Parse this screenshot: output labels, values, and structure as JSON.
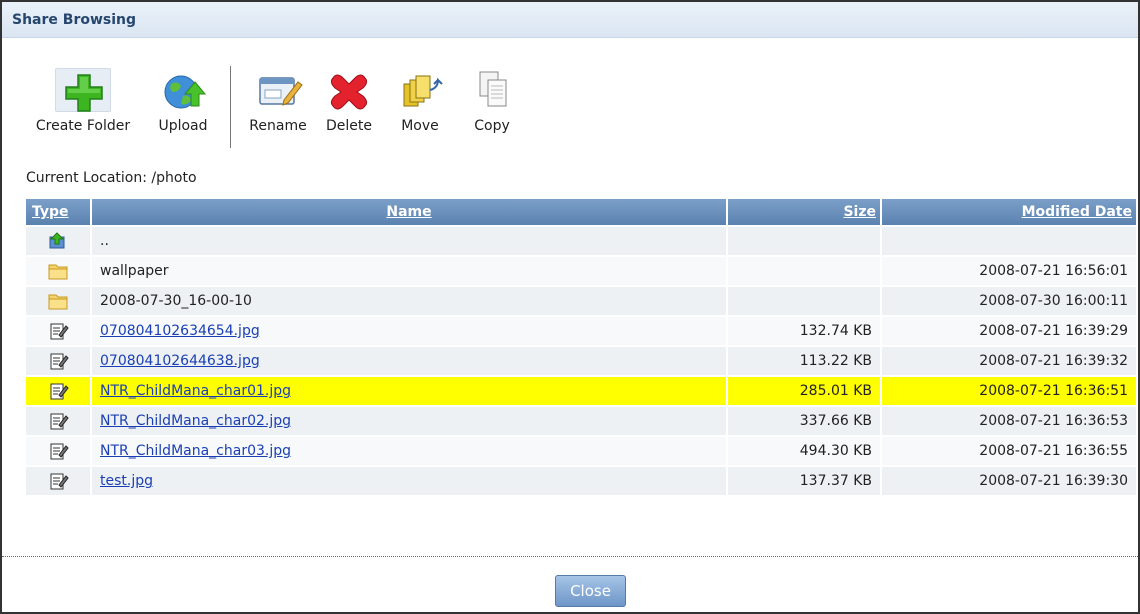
{
  "window": {
    "title": "Share Browsing"
  },
  "toolbar": {
    "create_folder": "Create Folder",
    "upload": "Upload",
    "rename": "Rename",
    "delete": "Delete",
    "move": "Move",
    "copy": "Copy"
  },
  "location": {
    "text": "Current Location: /photo"
  },
  "table": {
    "headers": {
      "type": "Type",
      "name": "Name",
      "size": "Size",
      "modified": "Modified Date"
    },
    "rows": [
      {
        "icon": "parent-folder-icon",
        "name": "..",
        "size": "",
        "modified": ""
      },
      {
        "icon": "folder-icon",
        "name": "wallpaper",
        "size": "",
        "modified": "2008-07-21 16:56:01"
      },
      {
        "icon": "folder-icon",
        "name": "2008-07-30_16-00-10",
        "size": "",
        "modified": "2008-07-30 16:00:11"
      },
      {
        "icon": "file-icon",
        "name": "070804102634654.jpg",
        "size": "132.74 KB",
        "modified": "2008-07-21 16:39:29"
      },
      {
        "icon": "file-icon",
        "name": "070804102644638.jpg",
        "size": "113.22 KB",
        "modified": "2008-07-21 16:39:32"
      },
      {
        "icon": "file-icon",
        "name": "NTR_ChildMana_char01.jpg",
        "size": "285.01 KB",
        "modified": "2008-07-21 16:36:51"
      },
      {
        "icon": "file-icon",
        "name": "NTR_ChildMana_char02.jpg",
        "size": "337.66 KB",
        "modified": "2008-07-21 16:36:53"
      },
      {
        "icon": "file-icon",
        "name": "NTR_ChildMana_char03.jpg",
        "size": "494.30 KB",
        "modified": "2008-07-21 16:36:55"
      },
      {
        "icon": "file-icon",
        "name": "test.jpg",
        "size": "137.37 KB",
        "modified": "2008-07-21 16:39:30"
      }
    ]
  },
  "footer": {
    "close_label": "Close"
  },
  "colors": {
    "highlight_row": "#ffff00",
    "header_bg": "#6a8fbc",
    "link": "#1a3fb4"
  }
}
